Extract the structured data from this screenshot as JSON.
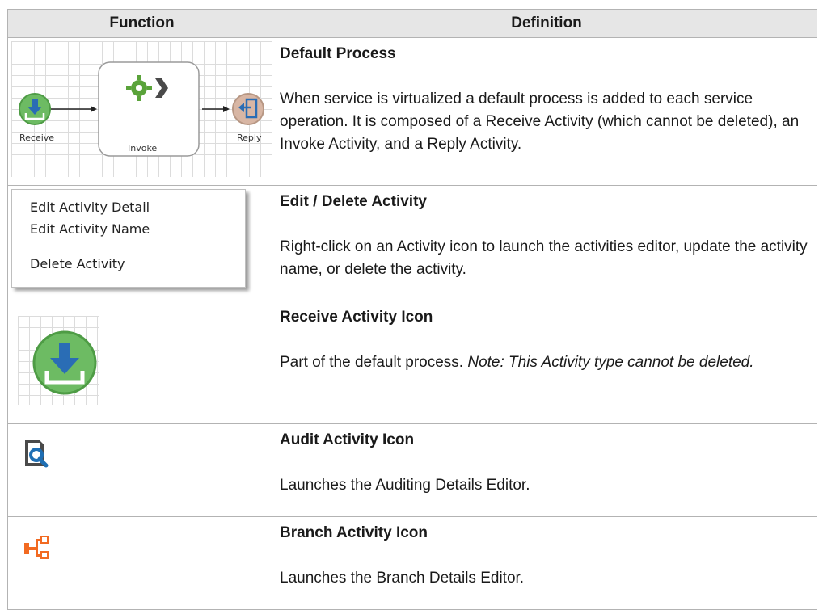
{
  "table": {
    "headers": {
      "function": "Function",
      "definition": "Definition"
    },
    "rows": [
      {
        "title": "Default Process",
        "body": "When service is virtualized a default process is added to each service operation. It is composed of a Receive Activity (which cannot be deleted), an Invoke Activity, and a Reply Activity.",
        "diagram": {
          "receive_label": "Receive",
          "invoke_label": "Invoke",
          "reply_label": "Reply"
        }
      },
      {
        "title": "Edit / Delete Activity",
        "body": "Right-click on an Activity icon to launch the activities editor, update the activity name, or delete the activity.",
        "menu": {
          "items": [
            "Edit Activity Detail",
            "Edit Activity Name",
            "Delete Activity"
          ]
        }
      },
      {
        "title": "Receive Activity Icon",
        "body": "Part of the default process.",
        "note": "Note: This Activity type cannot be deleted."
      },
      {
        "title": "Audit Activity Icon",
        "body": "Launches the Auditing Details Editor."
      },
      {
        "title": "Branch Activity Icon",
        "body": "Launches the Branch Details Editor."
      }
    ]
  },
  "colors": {
    "receive_green": "#6dbb63",
    "reply_tan": "#d8b6a4",
    "invoke_green": "#5aa33a",
    "audit_dark": "#4a4a4a",
    "audit_blue": "#1f6fb4",
    "branch_orange": "#f26a21",
    "header_bg": "#e6e6e6"
  }
}
